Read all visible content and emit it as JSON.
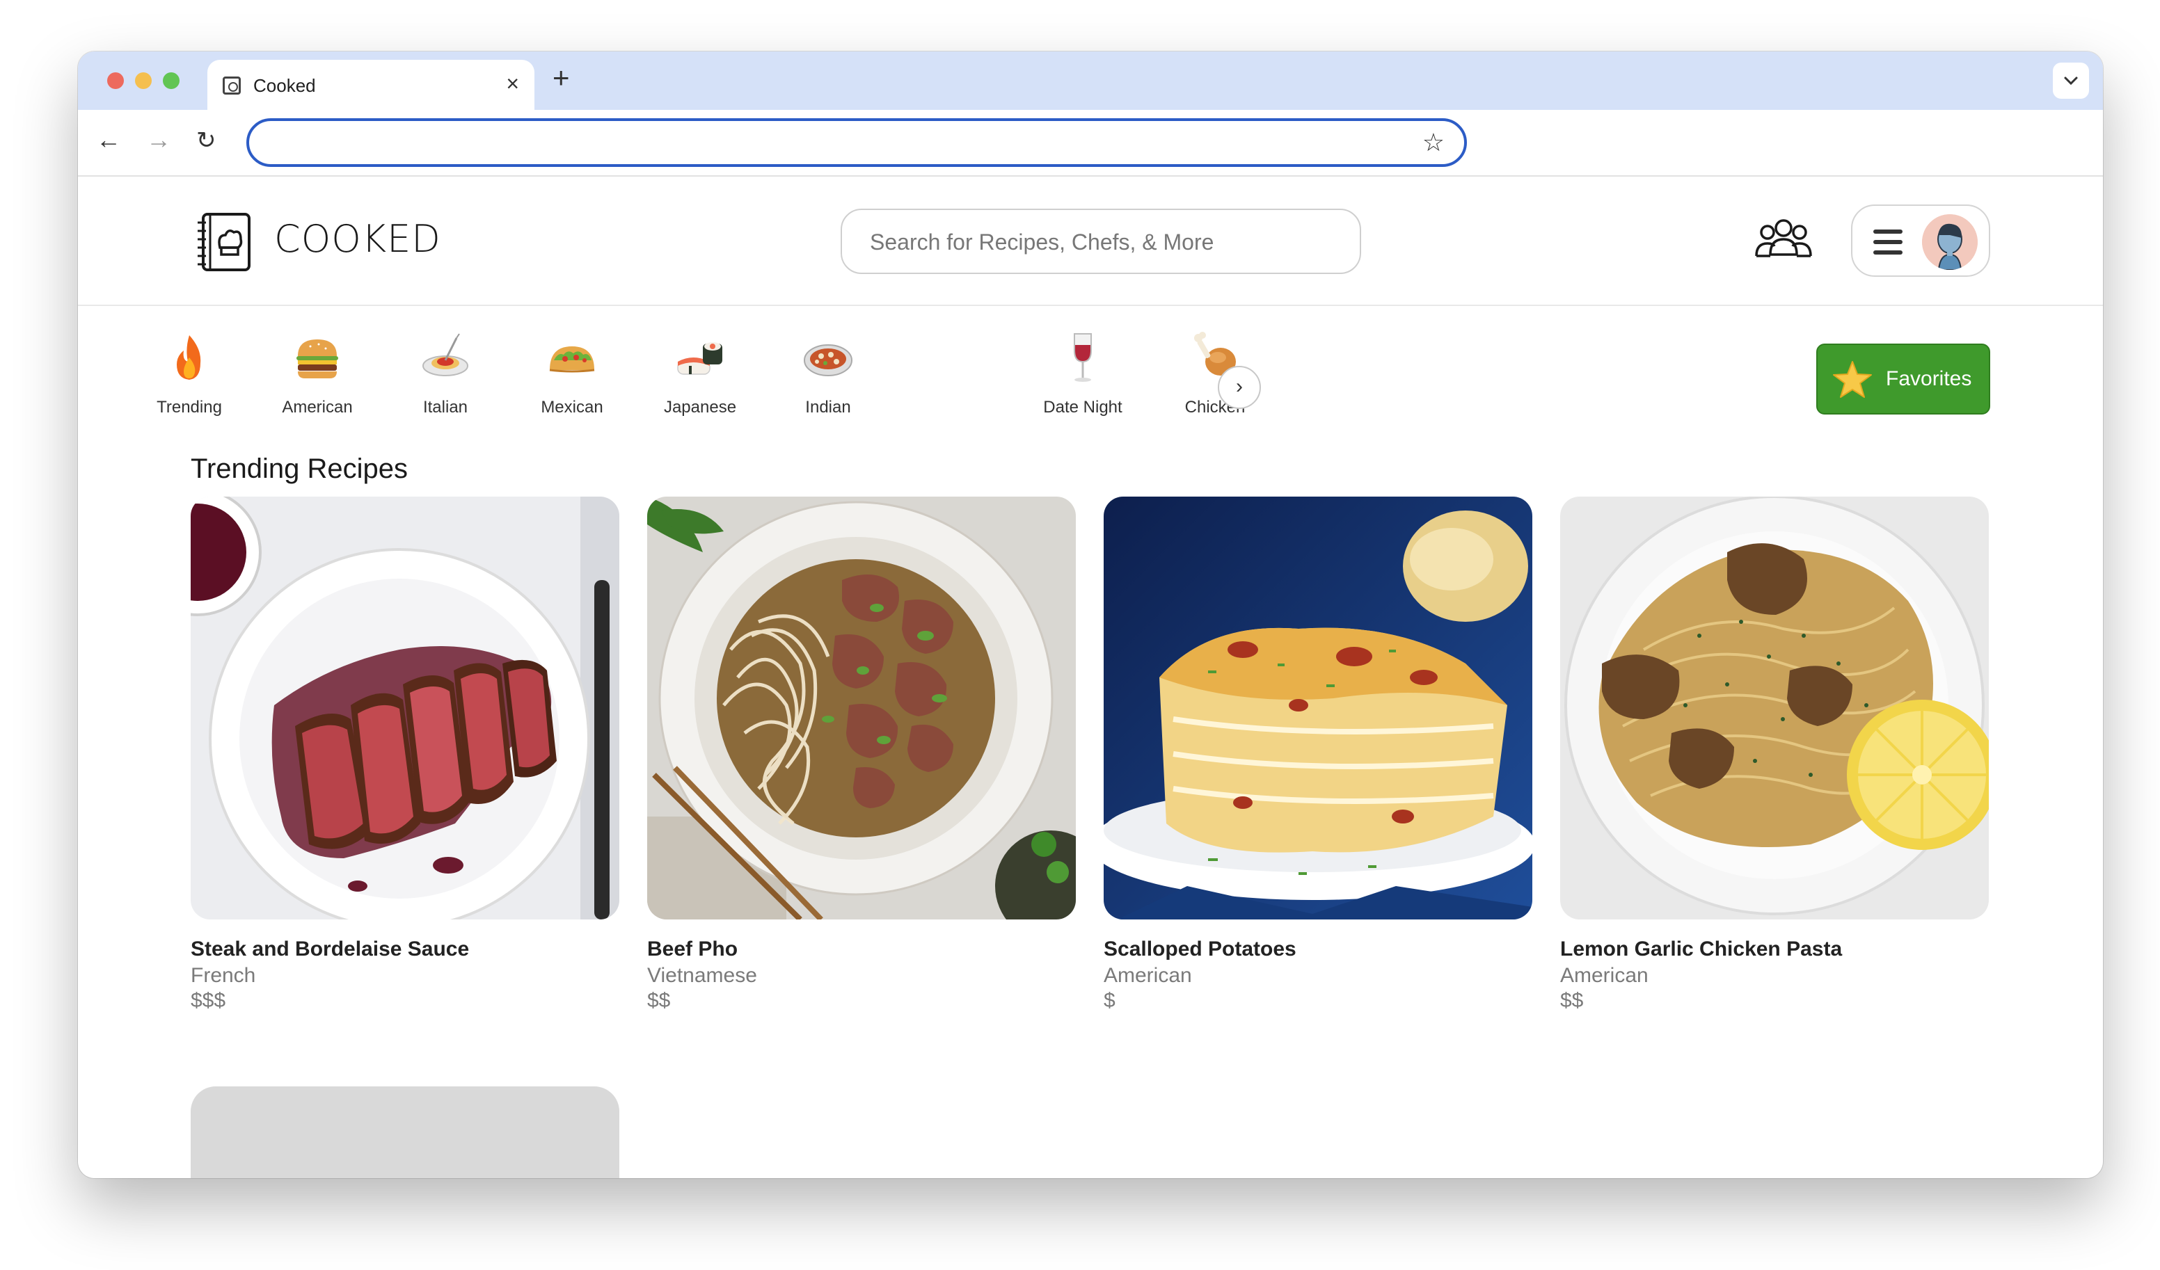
{
  "browser": {
    "tab_title": "Cooked",
    "close_glyph": "×",
    "new_tab_glyph": "+",
    "tab_menu_glyph": "⌄",
    "back_glyph": "←",
    "forward_glyph": "→",
    "reload_glyph": "↻",
    "url": "",
    "bookmark_glyph": "☆"
  },
  "header": {
    "logo_text": "COOKED",
    "search_placeholder": "Search for Recipes, Chefs, & More",
    "community_icon": "community-icon",
    "menu_icon": "hamburger-menu-icon",
    "avatar_icon": "user-avatar"
  },
  "categories": {
    "items": [
      {
        "label": "Trending",
        "icon": "fire-icon"
      },
      {
        "label": "American",
        "icon": "burger-icon"
      },
      {
        "label": "Italian",
        "icon": "spaghetti-icon"
      },
      {
        "label": "Mexican",
        "icon": "taco-icon"
      },
      {
        "label": "Japanese",
        "icon": "sushi-icon"
      },
      {
        "label": "Indian",
        "icon": "curry-icon"
      },
      {
        "label": "Date Night",
        "icon": "wine-glass-icon"
      },
      {
        "label": "Chicken",
        "icon": "drumstick-icon"
      }
    ],
    "next_glyph": "›"
  },
  "favorites": {
    "label": "Favorites",
    "color": "#3f9a2c"
  },
  "main": {
    "section_title": "Trending Recipes",
    "recipes": [
      {
        "name": "Steak and Bordelaise Sauce",
        "cuisine": "French",
        "price": "$$$"
      },
      {
        "name": "Beef Pho",
        "cuisine": "Vietnamese",
        "price": "$$"
      },
      {
        "name": "Scalloped Potatoes",
        "cuisine": "American",
        "price": "$"
      },
      {
        "name": "Lemon Garlic Chicken Pasta",
        "cuisine": "American",
        "price": "$$"
      }
    ]
  },
  "colors": {
    "tab_bar": "#d5e1f8",
    "omnibox_border": "#2c5cc6",
    "muted_text": "#7a7a7a"
  }
}
